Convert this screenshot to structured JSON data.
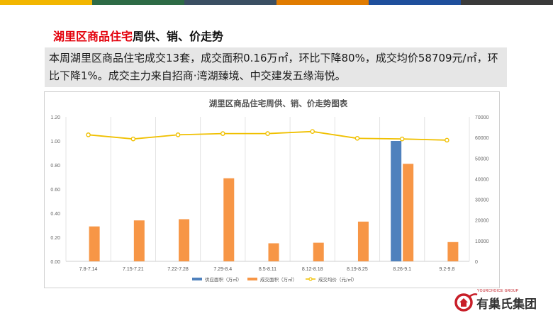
{
  "header": {
    "title_red": "湖里区商品住宅",
    "title_black": "周供、销、价走势",
    "stripe_colors": [
      "#f2b600",
      "#2e6b46",
      "#3b4f63",
      "#e07b00",
      "#1f4f9c",
      "#3a3a3a"
    ]
  },
  "summary": {
    "text": "本周湖里区商品住宅成交13套，成交面积0.16万㎡，环比下降80%，成交均价58709元/㎡，环比下降1%。成交主力来自招商·湾湖臻境、中交建发五缘海悦。"
  },
  "logo": {
    "tagline": "YOURCHOICE GROUP",
    "name": "有巢氏集团",
    "icon": "house-circle-logo-icon"
  },
  "chart_data": {
    "type": "bar",
    "title": "湖里区商品住宅周供、销、价走势图表",
    "categories": [
      "7.8-7.14",
      "7.15-7.21",
      "7.22-7.28",
      "7.29-8.4",
      "8.5-8.11",
      "8.12-8.18",
      "8.19-8.25",
      "8.26-9.1",
      "9.2-9.8"
    ],
    "series": [
      {
        "name": "供应面积（万㎡）",
        "type": "bar",
        "axis": "left",
        "color": "#4f81bd",
        "values": [
          0,
          0,
          0,
          0,
          0,
          0,
          0,
          1.0,
          0
        ]
      },
      {
        "name": "成交面积（万㎡）",
        "type": "bar",
        "axis": "left",
        "color": "#f79646",
        "values": [
          0.29,
          0.34,
          0.35,
          0.69,
          0.15,
          0.155,
          0.33,
          0.81,
          0.16
        ]
      },
      {
        "name": "成交均价（元/㎡）",
        "type": "line",
        "axis": "right",
        "color": "#f0c000",
        "values": [
          61300,
          59300,
          61300,
          61900,
          61900,
          62900,
          59600,
          59300,
          58709
        ]
      }
    ],
    "left_axis": {
      "min": 0,
      "max": 1.2,
      "ticks": [
        "0.00",
        "0.20",
        "0.40",
        "0.60",
        "0.80",
        "1.00",
        "1.20"
      ]
    },
    "right_axis": {
      "min": 0,
      "max": 70000,
      "ticks": [
        "0",
        "10000",
        "20000",
        "30000",
        "40000",
        "50000",
        "60000",
        "70000"
      ]
    },
    "grid": "vertical",
    "legend_position": "bottom"
  }
}
